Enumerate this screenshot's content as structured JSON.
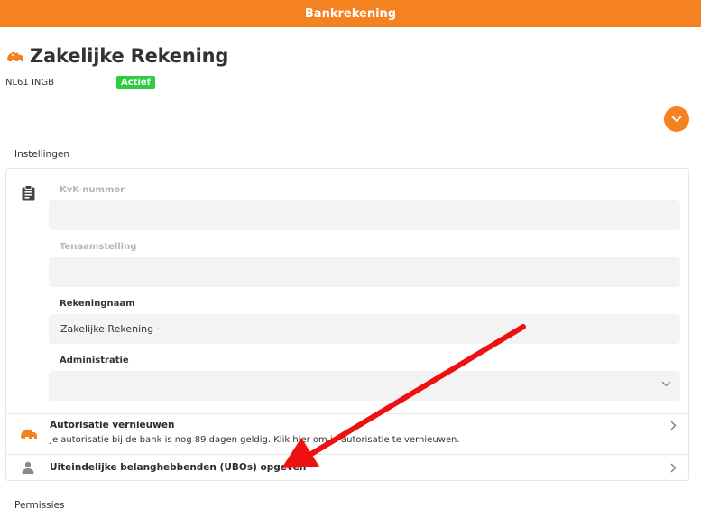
{
  "header": {
    "title": "Bankrekening"
  },
  "account": {
    "name": "Zakelijke Rekening",
    "iban": "NL61 INGB",
    "status": "Actief",
    "bank_icon": "ing-lion-icon"
  },
  "colors": {
    "accent": "#f58220",
    "status_active": "#2ecc40",
    "annotation_arrow": "#ee1111"
  },
  "sections": {
    "settings_title": "Instellingen",
    "permissions_title": "Permissies"
  },
  "settings": {
    "kvk_label": "KvK-nummer",
    "kvk_value": "",
    "tenaam_label": "Tenaamstelling",
    "tenaam_value": "",
    "rekeningnaam_label": "Rekeningnaam",
    "rekeningnaam_value": "Zakelijke Rekening ·",
    "administratie_label": "Administratie",
    "administratie_value": ""
  },
  "rows": {
    "autorisatie_title": "Autorisatie vernieuwen",
    "autorisatie_sub": "Je autorisatie bij de bank is nog 89 dagen geldig. Klik hier om je autorisatie te vernieuwen.",
    "ubo_title": "Uiteindelijke belanghebbenden (UBOs) opgeven"
  }
}
